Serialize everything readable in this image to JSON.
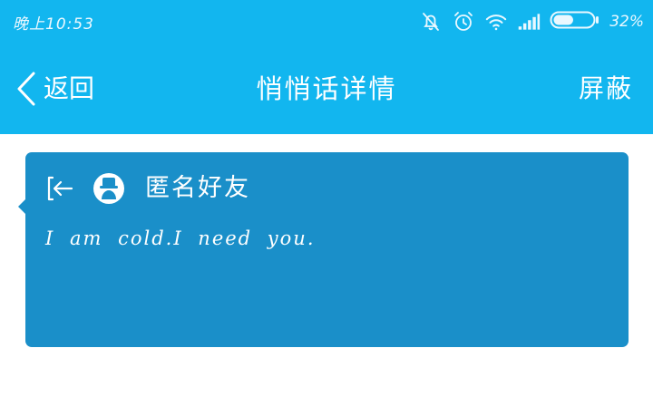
{
  "colors": {
    "header_bg": "#12b6ef",
    "card_bg": "#1a8fc9",
    "text_on_blue": "#ffffff"
  },
  "status_bar": {
    "time": "晚上10:53",
    "battery_percent": "32%",
    "battery_level": 0.32,
    "icons": [
      "mute-bell-icon",
      "alarm-clock-icon",
      "wifi-icon",
      "cell-signal-icon",
      "battery-icon"
    ]
  },
  "title_bar": {
    "back_label": "返回",
    "title": "悄悄话详情",
    "block_label": "屏蔽"
  },
  "whisper": {
    "sender": "匿名好友",
    "message": "I am cold.I need you."
  }
}
